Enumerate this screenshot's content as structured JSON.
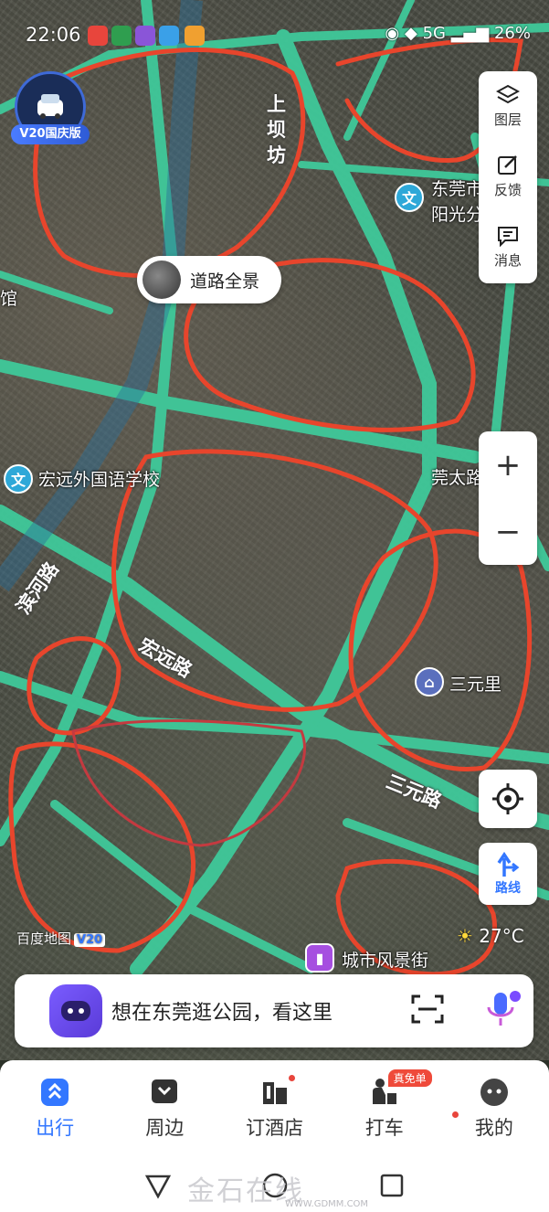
{
  "status_bar": {
    "time": "22:06",
    "signal_text": "5G",
    "battery": "26%"
  },
  "badge": {
    "label": "V20国庆版"
  },
  "tools": [
    {
      "label": "图层",
      "icon": "layers-icon"
    },
    {
      "label": "反馈",
      "icon": "feedback-edit-icon"
    },
    {
      "label": "消息",
      "icon": "message-icon"
    }
  ],
  "zoom": {
    "in": "+",
    "out": "−"
  },
  "street_view": {
    "label": "道路全景"
  },
  "map_labels": {
    "road_shangba": "上坝坊",
    "poi_dongguan_1": "东莞市",
    "poi_dongguan_2": "阳光分",
    "school": "宏远外国语学校",
    "road_binhe": "滨河路",
    "road_hongyuan": "宏远路",
    "road_sanyuan": "三元路",
    "poi_sanyuanli": "三元里",
    "poi_guantai": "莞太路",
    "poi_city_street": "城市风景街",
    "left_edge": "馆",
    "school_marker": "文"
  },
  "route": {
    "label": "路线"
  },
  "weather": {
    "text": "27°C"
  },
  "map_watermark": {
    "text": "百度地图",
    "version": "V20"
  },
  "search": {
    "placeholder": "想在东莞逛公园，看这里"
  },
  "nav": [
    {
      "label": "出行",
      "icon": "travel-icon",
      "active": true
    },
    {
      "label": "周边",
      "icon": "nearby-icon",
      "active": false
    },
    {
      "label": "订酒店",
      "icon": "hotel-icon",
      "active": false
    },
    {
      "label": "打车",
      "icon": "taxi-icon",
      "active": false,
      "badge": "真免单"
    },
    {
      "label": "我的",
      "icon": "profile-icon",
      "active": false
    }
  ],
  "watermark": {
    "site": "金石在线",
    "url": "WWW.GDMM.COM"
  },
  "colors": {
    "accent": "#3377ff",
    "road": "#4fd6a5",
    "annotation": "#e8452c"
  }
}
